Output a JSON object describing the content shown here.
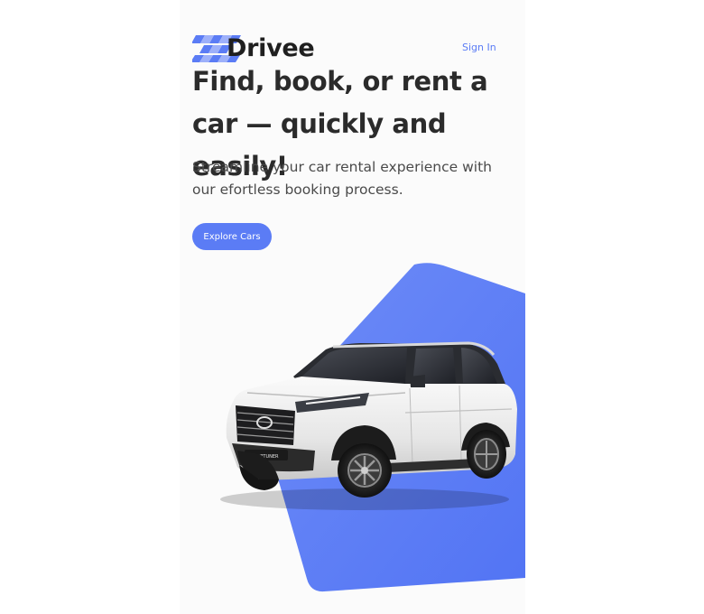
{
  "brand": {
    "name": "Drivee",
    "accent": "#5b7cf5"
  },
  "nav": {
    "sign_in": "Sign In"
  },
  "hero": {
    "headline": "Find, book, or rent a car — quickly and easily!",
    "subtext": "Streamline your car rental experience with our efortless booking process.",
    "cta_label": "Explore Cars",
    "image": "white-suv-car-image"
  }
}
